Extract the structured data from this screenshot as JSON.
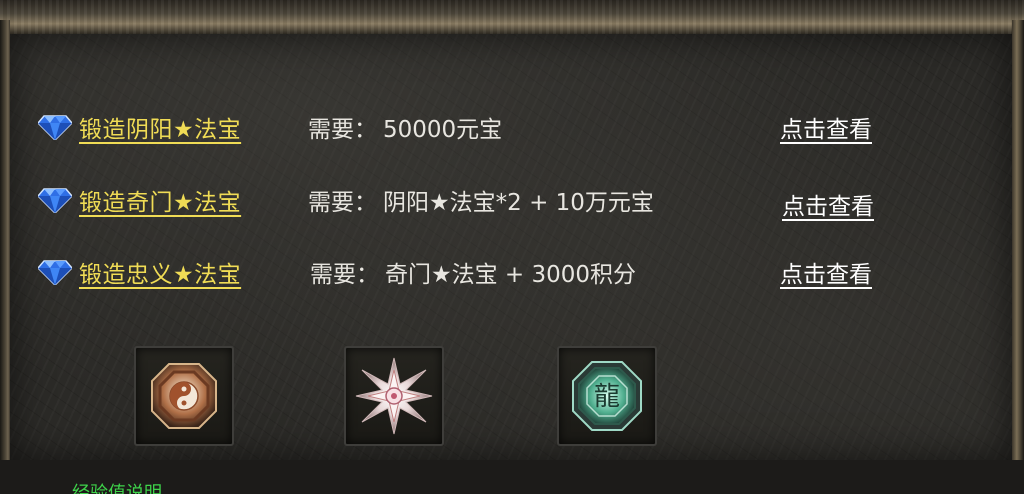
{
  "recipes": [
    {
      "title": "锻造阴阳★法宝",
      "req_label": "需要：",
      "req_value": "50000元宝",
      "action": "点击查看"
    },
    {
      "title": "锻造奇门★法宝",
      "req_label": "需要：",
      "req_value": "阴阳★法宝*2 + 10万元宝",
      "action": "点击查看"
    },
    {
      "title": "锻造忠义★法宝",
      "req_label": "需要：",
      "req_value": "奇门★法宝 + 3000积分",
      "action": "点击查看"
    }
  ],
  "item_slots": [
    {
      "icon": "yinyang-bagua-talisman-icon",
      "glow": "#e8c090"
    },
    {
      "icon": "star-compass-talisman-icon",
      "glow": "#f0e6e6"
    },
    {
      "icon": "dragon-jade-talisman-icon",
      "glow": "#7ad9b8",
      "glyph": "龍"
    }
  ],
  "bottom_text": "经验值说明",
  "colors": {
    "title": "#f0dc55",
    "action": "#ffffff",
    "req": "#e8e6e0",
    "gem": "#3a7cf0"
  }
}
